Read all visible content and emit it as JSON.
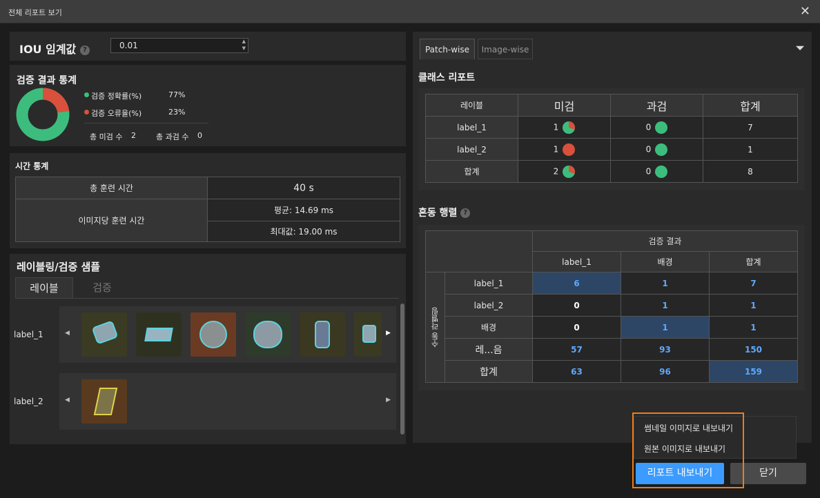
{
  "window": {
    "title": "전체 리포트 보기"
  },
  "iou": {
    "label": "IOU 임계값",
    "value": "0.01"
  },
  "result_stats": {
    "title": "검증 결과 통계",
    "accuracy_label": "검증 정확률(%)",
    "accuracy_value": "77%",
    "error_label": "검증 오류율(%)",
    "error_value": "23%",
    "total_miss_label": "총 미검 수",
    "total_miss_value": "2",
    "total_over_label": "총 과검 수",
    "total_over_value": "0",
    "accuracy": 0.77,
    "colors": {
      "accuracy": "#3dbd7d",
      "error": "#d9503c"
    }
  },
  "time_stats": {
    "title": "시간 통계",
    "total_train_label": "총 훈련 시간",
    "total_train_value": "40 s",
    "per_image_label": "이미지당 훈련 시간",
    "avg": "평균: 14.69 ms",
    "max": "최대값: 19.00 ms"
  },
  "samples": {
    "title": "레이블링/검증 샘플",
    "tabs": [
      "레이블",
      "검증"
    ],
    "rows": [
      {
        "label": "label_1",
        "thumb_count": 6
      },
      {
        "label": "label_2",
        "thumb_count": 1
      }
    ]
  },
  "report_tabs": [
    "Patch-wise",
    "Image-wise"
  ],
  "class_report": {
    "title": "클래스 리포트",
    "headers": [
      "레이블",
      "미검",
      "과검",
      "합계"
    ],
    "rows": [
      {
        "label": "label_1",
        "miss": "1",
        "over": "0",
        "total": "7",
        "miss_pie": 0.3
      },
      {
        "label": "label_2",
        "miss": "1",
        "over": "0",
        "total": "1",
        "miss_pie": 1
      },
      {
        "label": "합계",
        "miss": "2",
        "over": "0",
        "total": "8",
        "miss_pie": 0.3
      }
    ]
  },
  "confusion": {
    "title": "혼동 행렬",
    "col_group": "검증 결과",
    "row_group": "수동 라벨링",
    "cols": [
      "label_1",
      "배경",
      "합계"
    ],
    "rows": [
      {
        "label": "label_1",
        "vals": [
          "6",
          "1",
          "7"
        ]
      },
      {
        "label": "label_2",
        "vals": [
          "0",
          "1",
          "1"
        ]
      },
      {
        "label": "배경",
        "vals": [
          "0",
          "1",
          "1"
        ]
      },
      {
        "label": "레...음",
        "vals": [
          "57",
          "93",
          "150"
        ]
      },
      {
        "label": "합계",
        "vals": [
          "63",
          "96",
          "159"
        ]
      }
    ]
  },
  "export_menu": {
    "thumb": "썸네일 이미지로 내보내기",
    "original": "원본 이미지로 내보내기"
  },
  "buttons": {
    "export": "리포트 내보내기",
    "close": "닫기"
  }
}
